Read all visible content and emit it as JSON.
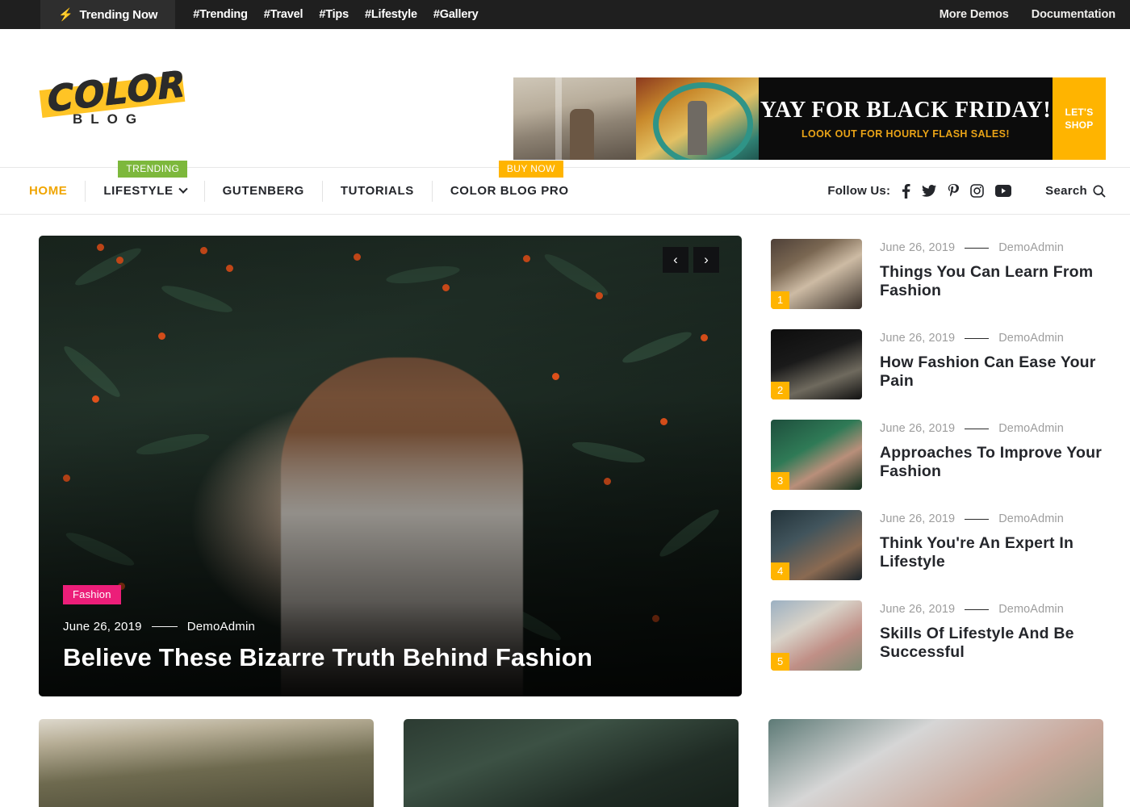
{
  "topbar": {
    "trending_label": "Trending Now",
    "bolt_icon": "lightning-bolt-icon",
    "hashtags": [
      "#Trending",
      "#Travel",
      "#Tips",
      "#Lifestyle",
      "#Gallery"
    ],
    "right_links": [
      "More Demos",
      "Documentation"
    ]
  },
  "header": {
    "logo_word": "COLOR",
    "logo_sub": "BLOG",
    "banner": {
      "title": "YAY FOR BLACK FRIDAY!",
      "subtitle": "LOOK OUT FOR HOURLY FLASH SALES!",
      "cta": "LET'S\nSHOP"
    }
  },
  "nav": {
    "items": [
      {
        "label": "HOME",
        "active": true,
        "caret": false,
        "badge": null
      },
      {
        "label": "LIFESTYLE",
        "active": false,
        "caret": true,
        "badge": "TRENDING"
      },
      {
        "label": "GUTENBERG",
        "active": false,
        "caret": false,
        "badge": null
      },
      {
        "label": "TUTORIALS",
        "active": false,
        "caret": false,
        "badge": null
      },
      {
        "label": "COLOR BLOG PRO",
        "active": false,
        "caret": false,
        "badge": "BUY NOW"
      }
    ],
    "follow_label": "Follow Us:",
    "social": [
      "facebook-icon",
      "twitter-icon",
      "pinterest-icon",
      "instagram-icon",
      "youtube-icon"
    ],
    "search_label": "Search"
  },
  "hero": {
    "category": "Fashion",
    "date": "June 26, 2019",
    "author": "DemoAdmin",
    "title": "Believe These Bizarre Truth Behind Fashion",
    "prev_icon": "chevron-left-icon",
    "next_icon": "chevron-right-icon"
  },
  "sidebar": {
    "items": [
      {
        "num": "1",
        "date": "June 26, 2019",
        "author": "DemoAdmin",
        "title": "Things You Can Learn From Fashion"
      },
      {
        "num": "2",
        "date": "June 26, 2019",
        "author": "DemoAdmin",
        "title": "How Fashion Can Ease Your Pain"
      },
      {
        "num": "3",
        "date": "June 26, 2019",
        "author": "DemoAdmin",
        "title": "Approaches To Improve Your Fashion"
      },
      {
        "num": "4",
        "date": "June 26, 2019",
        "author": "DemoAdmin",
        "title": "Think You're An Expert In Lifestyle"
      },
      {
        "num": "5",
        "date": "June 26, 2019",
        "author": "DemoAdmin",
        "title": "Skills Of Lifestyle And Be Successful"
      }
    ]
  },
  "cards": [
    {
      "name": "card-1"
    },
    {
      "name": "card-2"
    },
    {
      "name": "card-3"
    }
  ],
  "colors": {
    "accent_yellow": "#ffb400",
    "logo_yellow": "#ffc425",
    "green_badge": "#7db83c",
    "pink_badge": "#ec1e79",
    "dark_bar": "#1f1f1f",
    "text_dark": "#24262b"
  }
}
